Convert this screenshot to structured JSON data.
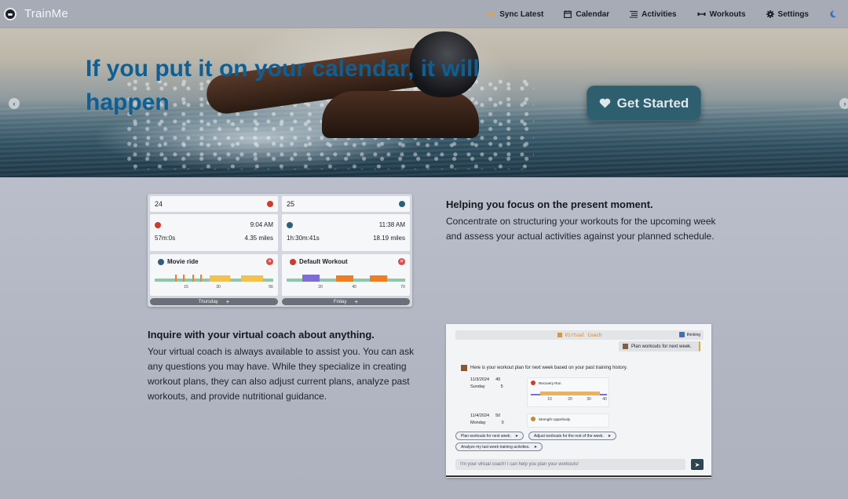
{
  "app": {
    "name": "TrainMe"
  },
  "nav": {
    "items": [
      {
        "label": "Sync Latest",
        "icon": "sync-icon"
      },
      {
        "label": "Calendar",
        "icon": "calendar-icon"
      },
      {
        "label": "Activities",
        "icon": "list-icon"
      },
      {
        "label": "Workouts",
        "icon": "dumbbell-icon"
      },
      {
        "label": "Settings",
        "icon": "gear-icon"
      }
    ],
    "theme_icon": "moon-icon"
  },
  "hero": {
    "title": "If you put it on your calendar, it will happen",
    "cta_label": "Get Started",
    "cta_icon": "heart-icon"
  },
  "calendar_preview": {
    "days": [
      {
        "number": "24",
        "activity": {
          "time": "9:04 AM",
          "duration": "57m:0s",
          "distance": "4.35 miles"
        },
        "workout": {
          "name": "Movie ride",
          "ticks": [
            "15",
            "30",
            "56"
          ]
        },
        "footer": "Thursday",
        "footer_add": "+"
      },
      {
        "number": "25",
        "activity": {
          "time": "11:38 AM",
          "duration": "1h:30m:41s",
          "distance": "18.19 miles"
        },
        "workout": {
          "name": "Default Workout",
          "ticks": [
            "20",
            "40",
            "70"
          ]
        },
        "footer": "Friday",
        "footer_add": "+"
      }
    ]
  },
  "feature_focus": {
    "title": "Helping you focus on the present moment.",
    "text": "Concentrate on structuring your workouts for the upcoming week and assess your actual activities against your planned schedule."
  },
  "feature_coach": {
    "title": "Inquire with your virtual coach about anything.",
    "text": "Your virtual coach is always available to assist you. You can ask any questions you may have. While they specialize in creating workout plans, they can also adjust current plans, analyze past workouts, and provide nutritional guidance."
  },
  "coach_preview": {
    "header": "Virtual Coach",
    "thinking_label": "thinking",
    "user_message": "Plan workouts for next week.",
    "coach_message": "Here is your workout plan for next week based on your past training history.",
    "plan": [
      {
        "date": "11/3/2024",
        "day": "Sunday",
        "values": [
          "40",
          "5"
        ],
        "workout": "Recovery Run",
        "ticks": [
          "10",
          "20",
          "30",
          "40"
        ]
      },
      {
        "date": "11/4/2024",
        "day": "Monday",
        "values": [
          "50",
          "0"
        ],
        "workout": "Strength Upperbody"
      }
    ],
    "suggestions": [
      "Plan workouts for next week.",
      "Adjust workouts for the rest of the week.",
      "Analyze my last week training activities."
    ],
    "input_placeholder": "I'm your virtual coach! I can help you plan your workouts!",
    "send_label": "➤"
  },
  "colors": {
    "accent": "#0f5f93",
    "cta": "#2d5f6e",
    "workout_orange": "#f2a93b",
    "workout_purple": "#7d6fd1",
    "workout_green": "#8cc9a7"
  }
}
